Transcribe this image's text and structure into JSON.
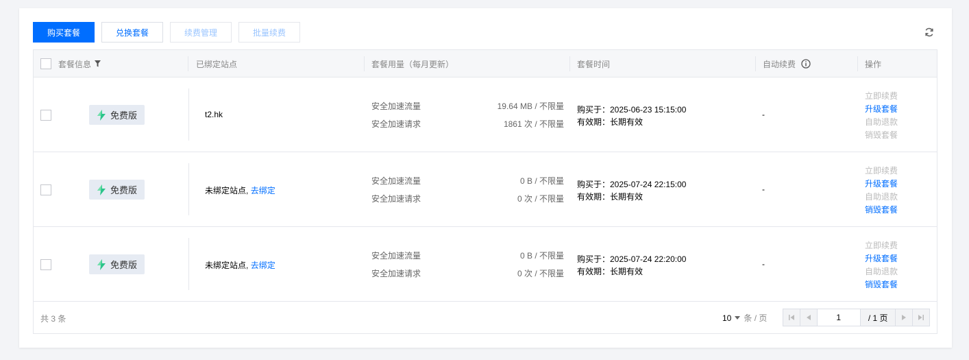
{
  "toolbar": {
    "buy_label": "购买套餐",
    "exchange_label": "兑换套餐",
    "renew_mgmt_label": "续费管理",
    "batch_renew_label": "批量续费",
    "refresh_icon": "refresh-icon"
  },
  "table": {
    "columns": {
      "package_info": "套餐信息",
      "bound_site": "已绑定站点",
      "usage": "套餐用量（每月更新）",
      "time": "套餐时间",
      "auto_renew": "自动续费",
      "actions": "操作"
    },
    "rows": [
      {
        "plan": "免费版",
        "site": "t2.hk",
        "site_link": "",
        "traffic_label": "安全加速流量",
        "traffic_value": "19.64 MB / 不限量",
        "requests_label": "安全加速请求",
        "requests_value": "1861 次 / 不限量",
        "purchased": "购买于：2025-06-23 15:15:00",
        "validity": "有效期：长期有效",
        "auto_renew": "-",
        "actions": [
          "立即续费",
          "升级套餐",
          "自助退款",
          "销毁套餐"
        ]
      },
      {
        "plan": "免费版",
        "site": "未绑定站点,",
        "site_link": "去绑定",
        "traffic_label": "安全加速流量",
        "traffic_value": "0 B / 不限量",
        "requests_label": "安全加速请求",
        "requests_value": "0 次 / 不限量",
        "purchased": "购买于：2025-07-24 22:15:00",
        "validity": "有效期：长期有效",
        "auto_renew": "-",
        "actions": [
          "立即续费",
          "升级套餐",
          "自助退款",
          "销毁套餐"
        ]
      },
      {
        "plan": "免费版",
        "site": "未绑定站点,",
        "site_link": "去绑定",
        "traffic_label": "安全加速流量",
        "traffic_value": "0 B / 不限量",
        "requests_label": "安全加速请求",
        "requests_value": "0 次 / 不限量",
        "purchased": "购买于：2025-07-24 22:20:00",
        "validity": "有效期：长期有效",
        "auto_renew": "-",
        "actions": [
          "立即续费",
          "升级套餐",
          "自助退款",
          "销毁套餐"
        ]
      }
    ]
  },
  "footer": {
    "total": "共 3 条",
    "page_size": "10",
    "page_size_unit": "条 / 页",
    "current_page": "1",
    "total_pages": "/ 1 页"
  },
  "colors": {
    "primary": "#006eff",
    "disabled_text": "#bbbbbb",
    "header_bg": "#f6f7f9"
  }
}
